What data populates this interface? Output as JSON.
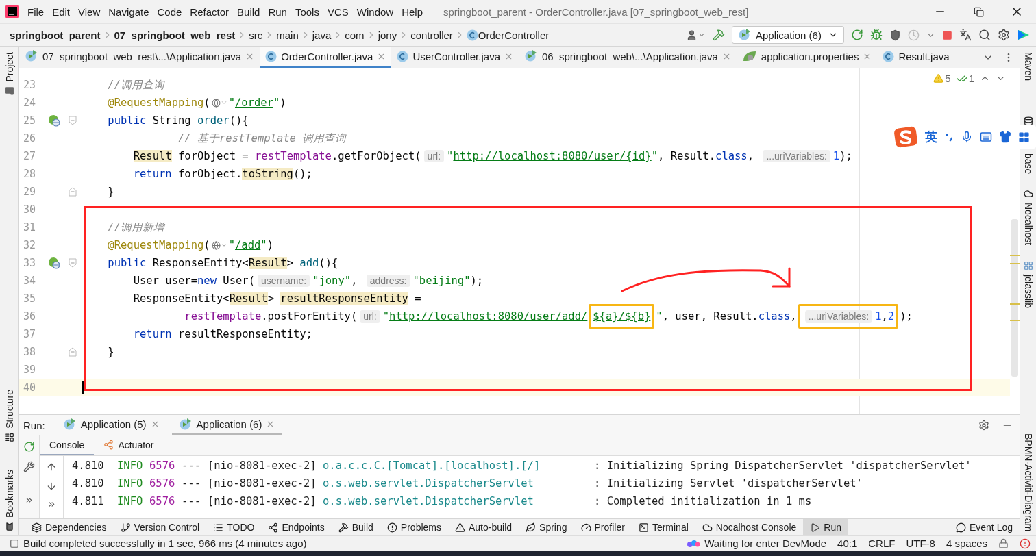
{
  "window": {
    "title": "springboot_parent - OrderController.java [07_springboot_web_rest]"
  },
  "menu": [
    "File",
    "Edit",
    "View",
    "Navigate",
    "Code",
    "Refactor",
    "Build",
    "Run",
    "Tools",
    "VCS",
    "Window",
    "Help"
  ],
  "breadcrumbs": [
    {
      "label": "springboot_parent",
      "kind": "module"
    },
    {
      "label": "07_springboot_web_rest",
      "kind": "module"
    },
    {
      "label": "src",
      "kind": "folder"
    },
    {
      "label": "main",
      "kind": "folder"
    },
    {
      "label": "java",
      "kind": "folder"
    },
    {
      "label": "com",
      "kind": "folder"
    },
    {
      "label": "jony",
      "kind": "folder"
    },
    {
      "label": "controller",
      "kind": "folder"
    },
    {
      "label": "OrderController",
      "kind": "class"
    }
  ],
  "run_config": {
    "label": "Application (6)"
  },
  "tabs": [
    {
      "label": "07_springboot_web_rest\\...\\Application.java",
      "kind": "app",
      "selected": false,
      "closable": true
    },
    {
      "label": "OrderController.java",
      "kind": "class",
      "selected": true,
      "closable": true
    },
    {
      "label": "UserController.java",
      "kind": "class",
      "selected": false,
      "closable": true
    },
    {
      "label": "06_springboot_web\\...\\Application.java",
      "kind": "app",
      "selected": false,
      "closable": true
    },
    {
      "label": "application.properties",
      "kind": "props",
      "selected": false,
      "closable": true
    },
    {
      "label": "Result.java",
      "kind": "class",
      "selected": false,
      "closable": false
    }
  ],
  "left_strip": {
    "top": [
      {
        "label": "Project",
        "kind": "project"
      }
    ],
    "bottom": [
      {
        "label": "Structure",
        "kind": "structure"
      },
      {
        "label": "Bookmarks",
        "kind": "bookmarks"
      }
    ]
  },
  "right_strip": {
    "top": [
      {
        "label": "Maven"
      },
      {
        "label": "base",
        "kind": "database"
      },
      {
        "label": "Nocalhost",
        "kind": "nocalhost"
      },
      {
        "label": "jclasslib",
        "kind": "jclasslib"
      }
    ],
    "bottom": [
      {
        "label": "BPMN-Activiti-Diagram"
      }
    ]
  },
  "inspections": {
    "warnings": "5",
    "weak_warnings": "1"
  },
  "ime": {
    "language": "英"
  },
  "editor": {
    "lines": [
      {
        "number": "23",
        "indent": {
          "kind": "member"
        },
        "current": false,
        "tokens": [
          {
            "kind": "comment",
            "text": "//调用查询"
          }
        ]
      },
      {
        "number": "24",
        "indent": {
          "kind": "member"
        },
        "current": false,
        "tokens": [
          {
            "kind": "ann",
            "text": "@RequestMapping"
          },
          {
            "kind": "plain",
            "text": "("
          },
          {
            "kind": "globe"
          },
          {
            "kind": "str",
            "text": "\""
          },
          {
            "kind": "url",
            "text": "/order"
          },
          {
            "kind": "str",
            "text": "\""
          },
          {
            "kind": "plain",
            "text": ")"
          }
        ]
      },
      {
        "number": "25",
        "indent": {
          "kind": "member"
        },
        "current": false,
        "marker": {
          "kind": "endpoint"
        },
        "fold": {
          "kind": "start"
        },
        "tokens": [
          {
            "kind": "kw",
            "text": "public"
          },
          {
            "kind": "plain",
            "text": " String "
          },
          {
            "kind": "decl",
            "text": "order"
          },
          {
            "kind": "plain",
            "text": "(){"
          }
        ]
      },
      {
        "number": "26",
        "indent": {
          "kind": "comment"
        },
        "current": false,
        "tokens": [
          {
            "kind": "comment",
            "text": "// 基于restTemplate 调用查询"
          }
        ]
      },
      {
        "number": "27",
        "indent": {
          "kind": "body"
        },
        "current": false,
        "tokens": [
          {
            "kind": "hl",
            "text": "Result"
          },
          {
            "kind": "plain",
            "text": " forObject = "
          },
          {
            "kind": "field",
            "text": "restTemplate"
          },
          {
            "kind": "plain",
            "text": ".getForObject("
          },
          {
            "kind": "hint",
            "text": "url:"
          },
          {
            "kind": "str",
            "text": "\""
          },
          {
            "kind": "url",
            "text": "http://localhost:8080/user/{id}"
          },
          {
            "kind": "str",
            "text": "\""
          },
          {
            "kind": "plain",
            "text": ", Result."
          },
          {
            "kind": "kw",
            "text": "class"
          },
          {
            "kind": "plain",
            "text": ", "
          },
          {
            "kind": "hint",
            "text": "...uriVariables:"
          },
          {
            "kind": "num",
            "text": "1"
          },
          {
            "kind": "plain",
            "text": ");"
          }
        ]
      },
      {
        "number": "28",
        "indent": {
          "kind": "body"
        },
        "current": false,
        "tokens": [
          {
            "kind": "kw",
            "text": "return"
          },
          {
            "kind": "plain",
            "text": " forObject."
          },
          {
            "kind": "hl",
            "text": "toString"
          },
          {
            "kind": "plain",
            "text": "();"
          }
        ]
      },
      {
        "number": "29",
        "indent": {
          "kind": "member"
        },
        "current": false,
        "fold": {
          "kind": "end"
        },
        "tokens": [
          {
            "kind": "plain",
            "text": "}"
          }
        ]
      },
      {
        "number": "30",
        "current": false
      },
      {
        "number": "31",
        "indent": {
          "kind": "member"
        },
        "current": false,
        "tokens": [
          {
            "kind": "comment",
            "text": "//调用新增"
          }
        ]
      },
      {
        "number": "32",
        "indent": {
          "kind": "member"
        },
        "current": false,
        "tokens": [
          {
            "kind": "ann",
            "text": "@RequestMapping"
          },
          {
            "kind": "plain",
            "text": "("
          },
          {
            "kind": "globe"
          },
          {
            "kind": "str",
            "text": "\""
          },
          {
            "kind": "url",
            "text": "/add"
          },
          {
            "kind": "str",
            "text": "\""
          },
          {
            "kind": "plain",
            "text": ")"
          }
        ]
      },
      {
        "number": "33",
        "indent": {
          "kind": "member"
        },
        "current": false,
        "marker": {
          "kind": "endpoint"
        },
        "fold": {
          "kind": "start"
        },
        "tokens": [
          {
            "kind": "kw",
            "text": "public"
          },
          {
            "kind": "plain",
            "text": " ResponseEntity<"
          },
          {
            "kind": "hl",
            "text": "Result"
          },
          {
            "kind": "plain",
            "text": "> "
          },
          {
            "kind": "decl",
            "text": "add"
          },
          {
            "kind": "plain",
            "text": "(){"
          }
        ]
      },
      {
        "number": "34",
        "indent": {
          "kind": "body"
        },
        "current": false,
        "tokens": [
          {
            "kind": "plain",
            "text": "User user="
          },
          {
            "kind": "kw",
            "text": "new"
          },
          {
            "kind": "plain",
            "text": " User("
          },
          {
            "kind": "hint",
            "text": "username:"
          },
          {
            "kind": "str",
            "text": "\"jony\""
          },
          {
            "kind": "plain",
            "text": ", "
          },
          {
            "kind": "hint",
            "text": "address:"
          },
          {
            "kind": "str",
            "text": "\"beijing\""
          },
          {
            "kind": "plain",
            "text": ");"
          }
        ]
      },
      {
        "number": "35",
        "indent": {
          "kind": "body"
        },
        "current": false,
        "tokens": [
          {
            "kind": "plain",
            "text": "ResponseEntity<"
          },
          {
            "kind": "hl",
            "text": "Result"
          },
          {
            "kind": "plain",
            "text": "> "
          },
          {
            "kind": "hl",
            "text": "resultResponseEntity"
          },
          {
            "kind": "plain",
            "text": " ="
          }
        ]
      },
      {
        "number": "36",
        "indent": {
          "kind": "wrap"
        },
        "current": false,
        "tokens": [
          {
            "kind": "field",
            "text": "restTemplate"
          },
          {
            "kind": "plain",
            "text": ".postForEntity("
          },
          {
            "kind": "hint",
            "text": "url:"
          },
          {
            "kind": "str",
            "text": "\""
          },
          {
            "kind": "url",
            "text": "http://localhost:8080/user/add/"
          },
          {
            "kind": "marked",
            "tokens": [
              {
                "kind": "url",
                "text": "${a}/${b}"
              }
            ]
          },
          {
            "kind": "str",
            "text": "\""
          },
          {
            "kind": "plain",
            "text": ", user, Result."
          },
          {
            "kind": "kw",
            "text": "class"
          },
          {
            "kind": "plain",
            "text": ","
          },
          {
            "kind": "marked",
            "tokens": [
              {
                "kind": "hint",
                "text": "...uriVariables:"
              },
              {
                "kind": "num",
                "text": "1"
              },
              {
                "kind": "plain",
                "text": ","
              },
              {
                "kind": "num",
                "text": "2"
              }
            ]
          },
          {
            "kind": "plain",
            "text": ");"
          }
        ]
      },
      {
        "number": "37",
        "indent": {
          "kind": "body"
        },
        "current": false,
        "tokens": [
          {
            "kind": "kw",
            "text": "return"
          },
          {
            "kind": "plain",
            "text": " resultResponseEntity;"
          }
        ]
      },
      {
        "number": "38",
        "indent": {
          "kind": "member"
        },
        "current": false,
        "fold": {
          "kind": "end"
        },
        "tokens": [
          {
            "kind": "plain",
            "text": "}"
          }
        ]
      },
      {
        "number": "39",
        "current": false
      },
      {
        "number": "40",
        "current": true
      }
    ]
  },
  "run_panel": {
    "label": "Run:",
    "tabs": [
      {
        "label": "Application (5)",
        "selected": false
      },
      {
        "label": "Application (6)",
        "selected": true
      }
    ],
    "subtabs": [
      {
        "label": "Console",
        "kind": "console",
        "selected": true
      },
      {
        "label": "Actuator",
        "kind": "actuator",
        "selected": false
      }
    ],
    "log": [
      {
        "time": "4.810",
        "level": "INFO",
        "pid": "6576",
        "sep": "---",
        "thread": "[nio-8081-exec-2]",
        "logger": "o.a.c.c.C.[Tomcat].[localhost].[/]",
        "message": ": Initializing Spring DispatcherServlet 'dispatcherServlet'"
      },
      {
        "time": "4.810",
        "level": "INFO",
        "pid": "6576",
        "sep": "---",
        "thread": "[nio-8081-exec-2]",
        "logger": "o.s.web.servlet.DispatcherServlet",
        "message": ": Initializing Servlet 'dispatcherServlet'"
      },
      {
        "time": "4.811",
        "level": "INFO",
        "pid": "6576",
        "sep": "---",
        "thread": "[nio-8081-exec-2]",
        "logger": "o.s.web.servlet.DispatcherServlet",
        "message": ": Completed initialization in 1 ms"
      }
    ]
  },
  "tool_windows": [
    {
      "label": "Dependencies",
      "kind": "dependencies",
      "selected": false
    },
    {
      "label": "Version Control",
      "kind": "vcs",
      "selected": false
    },
    {
      "label": "TODO",
      "kind": "todo",
      "selected": false
    },
    {
      "label": "Endpoints",
      "kind": "endpoints",
      "selected": false
    },
    {
      "label": "Build",
      "kind": "build",
      "selected": false
    },
    {
      "label": "Problems",
      "kind": "problems",
      "selected": false
    },
    {
      "label": "Auto-build",
      "kind": "autobuild",
      "selected": false
    },
    {
      "label": "Spring",
      "kind": "spring",
      "selected": false
    },
    {
      "label": "Profiler",
      "kind": "profiler",
      "selected": false
    },
    {
      "label": "Terminal",
      "kind": "terminal",
      "selected": false
    },
    {
      "label": "Nocalhost Console",
      "kind": "nocalhost",
      "selected": false
    },
    {
      "label": "Run",
      "kind": "run",
      "selected": true
    }
  ],
  "event_log": {
    "label": "Event Log"
  },
  "status_bar": {
    "message": "Build completed successfully in 1 sec, 966 ms (4 minutes ago)",
    "devmode": "Waiting for enter DevMode",
    "items": [
      "40:1",
      "CRLF",
      "UTF-8",
      "4 spaces"
    ]
  }
}
